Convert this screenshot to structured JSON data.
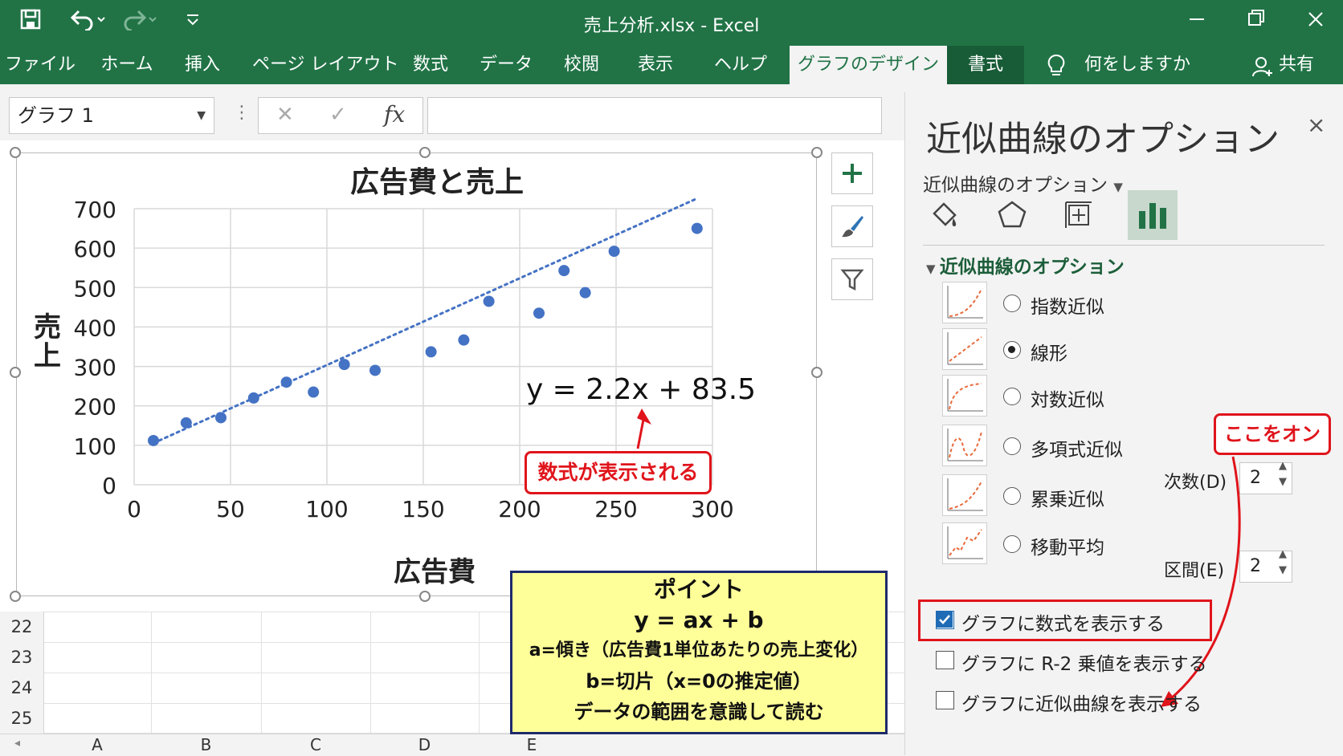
{
  "window": {
    "title": "売上分析.xlsx  -  Excel",
    "minimize_icon": "minimize-icon",
    "restore_icon": "restore-icon",
    "close_icon": "close-icon"
  },
  "ribbon": {
    "tabs": [
      {
        "label": "ファイル"
      },
      {
        "label": "ホーム"
      },
      {
        "label": "挿入"
      },
      {
        "label": "ページ レイアウト"
      },
      {
        "label": "数式"
      },
      {
        "label": "データ"
      },
      {
        "label": "校閲"
      },
      {
        "label": "表示"
      },
      {
        "label": "ヘルプ"
      },
      {
        "label": "グラフのデザイン"
      },
      {
        "label": "書式"
      }
    ],
    "tell_me": "何をしますか",
    "share": "共有"
  },
  "formula_bar": {
    "name_box": "グラフ 1",
    "cancel_symbol": "✕",
    "enter_symbol": "✓",
    "fx_symbol": "fx",
    "value": ""
  },
  "sheet": {
    "rows": [
      "22",
      "23",
      "24",
      "25"
    ],
    "columns": [
      "A",
      "B",
      "C",
      "D",
      "E"
    ]
  },
  "chart_data": {
    "type": "scatter",
    "title": "広告費と売上",
    "xlabel": "広告費",
    "ylabel": "売上",
    "xlim": [
      0,
      300
    ],
    "ylim": [
      0,
      700
    ],
    "xticks": [
      "0",
      "50",
      "100",
      "150",
      "200",
      "250",
      "300"
    ],
    "yticks": [
      "0",
      "100",
      "200",
      "300",
      "400",
      "500",
      "600",
      "700"
    ],
    "grid": true,
    "legend": "none",
    "points": [
      {
        "x": 10,
        "y": 112
      },
      {
        "x": 27,
        "y": 157
      },
      {
        "x": 45,
        "y": 170
      },
      {
        "x": 62,
        "y": 220
      },
      {
        "x": 79,
        "y": 260
      },
      {
        "x": 93,
        "y": 235
      },
      {
        "x": 109,
        "y": 305
      },
      {
        "x": 125,
        "y": 290
      },
      {
        "x": 154,
        "y": 337
      },
      {
        "x": 171,
        "y": 367
      },
      {
        "x": 184,
        "y": 465
      },
      {
        "x": 210,
        "y": 435
      },
      {
        "x": 223,
        "y": 543
      },
      {
        "x": 234,
        "y": 487
      },
      {
        "x": 249,
        "y": 592
      },
      {
        "x": 292,
        "y": 650
      }
    ],
    "trendline": {
      "type": "linear",
      "slope": 2.2,
      "intercept": 83.5,
      "x_range": [
        10,
        292
      ]
    },
    "equation": "y = 2.2x + 83.5",
    "point_color": "#4472c4"
  },
  "callouts": {
    "equation_note": "数式が表示される",
    "switch_on": "ここをオン"
  },
  "point_box": {
    "lines": [
      "ポイント",
      "y = ax + b",
      "a=傾き（広告費1単位あたりの売上変化）",
      "b=切片（x=0の推定値）",
      "データの範囲を意識して読む"
    ]
  },
  "pane": {
    "title": "近似曲線のオプション",
    "dropdown": "近似曲線のオプション",
    "section": "近似曲線のオプション",
    "close": "×",
    "icons": [
      "fill-line-icon",
      "effects-icon",
      "size-properties-icon",
      "trendline-options-icon"
    ],
    "options": [
      {
        "label": "指数近似",
        "selected": false
      },
      {
        "label": "線形",
        "selected": true
      },
      {
        "label": "対数近似",
        "selected": false
      },
      {
        "label": "多項式近似",
        "selected": false
      },
      {
        "label": "累乗近似",
        "selected": false
      },
      {
        "label": "移動平均",
        "selected": false
      }
    ],
    "order_label": "次数(D)",
    "order_value": "2",
    "period_label": "区間(E)",
    "period_value": "2",
    "checkboxes": [
      {
        "label": "グラフに数式を表示する",
        "checked": true
      },
      {
        "label": "グラフに R-2 乗値を表示する",
        "checked": false
      },
      {
        "label": "グラフに近似曲線を表示する",
        "checked": false
      }
    ]
  },
  "colors": {
    "excel_green": "#217346",
    "highlight_red": "#e0141b",
    "note_yellow": "#ffff99",
    "note_border": "#1f2a6b"
  }
}
